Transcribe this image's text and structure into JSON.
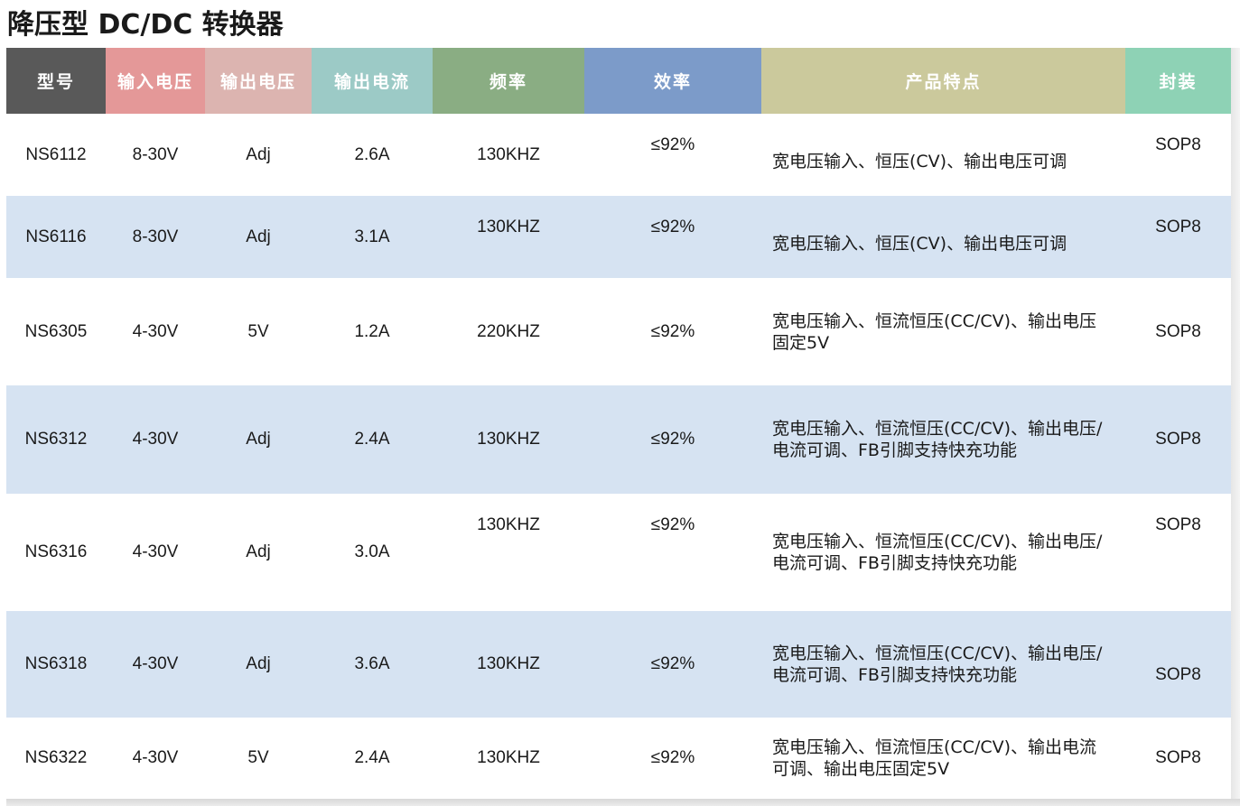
{
  "title": "降压型 DC/DC 转换器",
  "colors": {
    "row_white": "#ffffff",
    "row_blue": "#d6e3f2",
    "header": [
      "#595959",
      "#e49898",
      "#dcb4b0",
      "#9ccac6",
      "#8aad83",
      "#7c9bc9",
      "#cbc99c",
      "#8ed2b5"
    ]
  },
  "headers": [
    "型号",
    "输入电压",
    "输出电压",
    "输出电流",
    "频率",
    "效率",
    "产品特点",
    "封装"
  ],
  "rows": [
    [
      "NS6112",
      "8-30V",
      "Adj",
      "2.6A",
      "130KHZ",
      "≤92%",
      "宽电压输入、恒压(CV)、输出电压可调",
      "SOP8"
    ],
    [
      "NS6116",
      "8-30V",
      "Adj",
      "3.1A",
      "130KHZ",
      "≤92%",
      "宽电压输入、恒压(CV)、输出电压可调",
      "SOP8"
    ],
    [
      "NS6305",
      "4-30V",
      "5V",
      "1.2A",
      "220KHZ",
      "≤92%",
      "宽电压输入、恒流恒压(CC/CV)、输出电压\n固定5V",
      "SOP8"
    ],
    [
      "NS6312",
      "4-30V",
      "Adj",
      "2.4A",
      "130KHZ",
      "≤92%",
      "宽电压输入、恒流恒压(CC/CV)、输出电压/\n电流可调、FB引脚支持快充功能",
      "SOP8"
    ],
    [
      "NS6316",
      "4-30V",
      "Adj",
      "3.0A",
      "130KHZ",
      "≤92%",
      "宽电压输入、恒流恒压(CC/CV)、输出电压/\n电流可调、FB引脚支持快充功能",
      "SOP8"
    ],
    [
      "NS6318",
      "4-30V",
      "Adj",
      "3.6A",
      "130KHZ",
      "≤92%",
      "宽电压输入、恒流恒压(CC/CV)、输出电压/\n电流可调、FB引脚支持快充功能",
      "SOP8"
    ],
    [
      "NS6322",
      "4-30V",
      "5V",
      "2.4A",
      "130KHZ",
      "≤92%",
      "宽电压输入、恒流恒压(CC/CV)、输出电流\n可调、输出电压固定5V",
      "SOP8"
    ]
  ]
}
